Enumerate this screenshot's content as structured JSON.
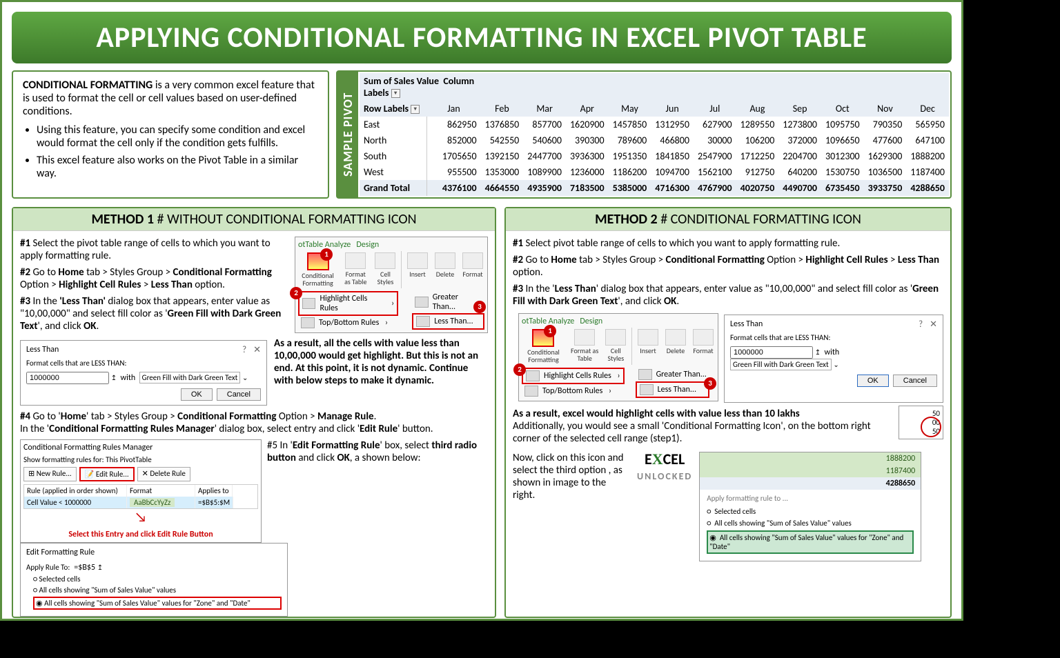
{
  "title": "APPLYING CONDITIONAL FORMATTING IN EXCEL PIVOT TABLE",
  "intro": {
    "lead_bold": "CONDITIONAL FORMATTING",
    "lead_rest": " is a very common excel feature that is used to format the cell or cell values based on user-defined conditions.",
    "b1": "Using this feature, you can specify some condition and excel would format the cell only if the condition gets fulfills.",
    "b2": "This excel feature also works on the Pivot Table in a similar way."
  },
  "sample_label": "SAMPLE PIVOT",
  "pivot": {
    "corner": "Sum of Sales Value",
    "col_lbl": "Column Labels",
    "row_lbl": "Row Labels",
    "months": [
      "Jan",
      "Feb",
      "Mar",
      "Apr",
      "May",
      "Jun",
      "Jul",
      "Aug",
      "Sep",
      "Oct",
      "Nov",
      "Dec"
    ],
    "rows": [
      {
        "r": "East",
        "v": [
          862950,
          1376850,
          857700,
          1620900,
          1457850,
          1312950,
          627900,
          1289550,
          1273800,
          1095750,
          790350,
          565950
        ]
      },
      {
        "r": "North",
        "v": [
          852000,
          542550,
          540600,
          390300,
          789600,
          466800,
          30000,
          106200,
          372000,
          1096650,
          477600,
          647100
        ]
      },
      {
        "r": "South",
        "v": [
          1705650,
          1392150,
          2447700,
          3936300,
          1951350,
          1841850,
          2547900,
          1712250,
          2204700,
          3012300,
          1629300,
          1888200
        ]
      },
      {
        "r": "West",
        "v": [
          955500,
          1353000,
          1089900,
          1236000,
          1186200,
          1094700,
          1562100,
          912750,
          640200,
          1530750,
          1036500,
          1187400
        ]
      }
    ],
    "gt_lbl": "Grand Total",
    "gt": [
      4376100,
      4664550,
      4935900,
      7183500,
      5385000,
      4716300,
      4767900,
      4020750,
      4490700,
      6735450,
      3933750,
      4288650
    ]
  },
  "m1": {
    "hdr_b": "METHOD 1",
    "hdr_r": " # WITHOUT CONDITIONAL FORMATTING ICON",
    "s1a": "#1 ",
    "s1b": "Select the pivot table range of cells to which you want to apply formatting rule.",
    "s2a": "#2 ",
    "s2b": "Go to ",
    "s2c": "Home",
    "s2d": " tab > Styles Group > ",
    "s2e": "Conditional Formatting",
    "s2f": " Option > ",
    "s2g": "Highlight Cell Rules",
    "s2h": " > ",
    "s2i": "Less Than",
    "s2j": " option.",
    "s3a": "#3 ",
    "s3b": "In the ",
    "s3c": "'Less Than'",
    "s3d": " dialog box that appears, enter value as \"10,00,000\" and select fill color as  '",
    "s3e": "Green Fill with Dark Green Text",
    "s3f": "', and click ",
    "s3g": "OK",
    "s3h": ".",
    "result": "As a result, all the cells with value less than 10,00,000 would get highlight. But this is not an end. At this point, it is not dynamic. Continue with below steps to make it dynamic.",
    "s4a": "#4 ",
    "s4b": "Go to '",
    "s4c": "Home",
    "s4d": "' tab > Styles Group > ",
    "s4e": "Conditional Formatting",
    "s4f": " Option > ",
    "s4g": "Manage Rule",
    "s4h": ".",
    "s4i": "In the '",
    "s4j": "Conditional Formatting Rules Manager",
    "s4k": "' dialog box, select entry and click '",
    "s4l": "Edit Rule",
    "s4m": "' button.",
    "s5a": "#5 In '",
    "s5b": "Edit Formatting Rule",
    "s5c": "' box, select ",
    "s5d": "third radio button",
    "s5e": " and click ",
    "s5f": "OK",
    "s5g": ", a shown below:",
    "red": "Select this Entry and click Edit Rule Button"
  },
  "m2": {
    "hdr_b": "METHOD 2",
    "hdr_r": " # CONDITIONAL FORMATTING ICON",
    "s1a": "#1 ",
    "s1b": "Select pivot table range of cells to which you want to apply formatting rule.",
    "s2a": "#2 ",
    "s2b": "Go to ",
    "s2c": "Home",
    "s2d": " tab > Styles Group > ",
    "s2e": "Conditional Formatting",
    "s2f": " Option > ",
    "s2g": "Highlight Cell Rules",
    "s2h": " > ",
    "s2i": "Less Than",
    "s2j": " option.",
    "s3a": "#3 ",
    "s3b": "In the '",
    "s3c": "Less Than",
    "s3d": "' dialog box that appears, enter value as \"10,00,000\" and select fill color as  '",
    "s3e": "Green Fill with Dark Green Text",
    "s3f": "', and click ",
    "s3g": "OK",
    "s3h": ".",
    "res_b": "As a result, excel would highlight cells with value less than 10 lakhs",
    "res2": "Additionally, you would see a small 'Conditional Formatting Icon', on the bottom right corner of the selected cell range (step1).",
    "res3": "Now, click on this icon and select the third option , as shown in image to the right."
  },
  "ribbon": {
    "tab1": "otTable Analyze",
    "tab2": "Design",
    "cf": "Conditional Formatting",
    "fat": "Format as Table",
    "cs": "Cell Styles",
    "ins": "Insert",
    "del": "Delete",
    "fmt": "Format",
    "hcr": "Highlight Cells Rules",
    "tbr": "Top/Bottom Rules",
    "gt": "Greater Than...",
    "lt": "Less Than..."
  },
  "less_dlg": {
    "ttl": "Less Than",
    "lbl": "Format cells that are LESS THAN:",
    "val": "1000000",
    "with": "with",
    "fill": "Green Fill with Dark Green Text",
    "ok": "OK",
    "cancel": "Cancel"
  },
  "rules": {
    "ttl": "Conditional Formatting Rules Manager",
    "show": "Show formatting rules for:",
    "scope": "This PivotTable",
    "new": "New Rule...",
    "edit": "Edit Rule...",
    "del": "Delete Rule",
    "c1": "Rule (applied in order shown)",
    "c2": "Format",
    "c3": "Applies to",
    "rule": "Cell Value < 1000000",
    "fmt": "AaBbCcYyZz",
    "ref": "=$B$5:$M"
  },
  "edit": {
    "ttl": "Edit Formatting Rule",
    "apply": "Apply Rule To:",
    "ref": "=$B$5",
    "r1": "Selected cells",
    "r2": "All cells showing \"Sum of Sales Value\" values",
    "r3": "All cells showing \"Sum of Sales Value\" values for \"Zone\" and \"Date\""
  },
  "popup": {
    "ttl": "Apply formatting rule to ...",
    "r1": "Selected cells",
    "r2": "All cells showing \"Sum of Sales Value\" values",
    "r3": "All cells showing \"Sum of Sales Value\" values for \"Zone\" and \"Date\"",
    "v1": "1888200",
    "v2": "1187400",
    "v3": "4288650"
  },
  "logo": {
    "l1": "E",
    "l2": "X",
    "l3": "CEL",
    "l4": "UNLOCKED"
  }
}
